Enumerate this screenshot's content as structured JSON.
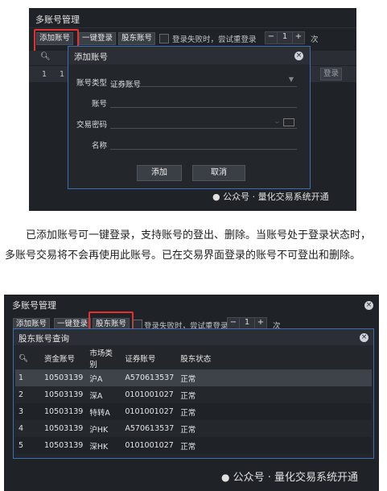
{
  "s1": {
    "window_title": "多账号管理",
    "toolbar": {
      "add_label": "添加账号",
      "onekey_label": "一键登录",
      "holder_label": "股东账号",
      "retry_text": "登录失败时，尝试重登录",
      "retry_value": "1",
      "retry_unit": "次"
    },
    "bg_row_num": "1",
    "bg_row_num2": "1",
    "bg_login": "登录",
    "dialog": {
      "title": "添加账号",
      "type_label": "账号类型",
      "type_value": "证券账号",
      "account_label": "账号",
      "password_label": "交易密码",
      "name_label": "名称",
      "add_button": "添加",
      "cancel_button": "取消"
    },
    "watermark": "公众号 · 量化交易系统开通"
  },
  "paragraph": "已添加账号可一键登录，支持账号的登出、删除。当账号处于登录状态时，多账号交易将不会再使用此账号。已在交易界面登录的账号不可登出和删除。",
  "s2": {
    "window_title": "多账号管理",
    "toolbar": {
      "add_label": "添加账号",
      "onekey_label": "一键登录",
      "holder_label": "股东账号",
      "retry_text": "登录失败时，尝试重登录",
      "retry_value": "1",
      "retry_unit": "次"
    },
    "dialog_title": "股东账号查询",
    "columns": [
      "资金账号",
      "市场类别",
      "证券账号",
      "股东状态"
    ],
    "rows": [
      {
        "n": "1",
        "fund": "10503139",
        "market": "沪A",
        "sec": "A570613537",
        "status": "正常"
      },
      {
        "n": "2",
        "fund": "10503139",
        "market": "深A",
        "sec": "0101001027",
        "status": "正常"
      },
      {
        "n": "3",
        "fund": "10503139",
        "market": "特转A",
        "sec": "0101001027",
        "status": "正常"
      },
      {
        "n": "4",
        "fund": "10503139",
        "market": "沪HK",
        "sec": "A570613537",
        "status": "正常"
      },
      {
        "n": "5",
        "fund": "10503139",
        "market": "深HK",
        "sec": "0101001027",
        "status": "正常"
      }
    ],
    "watermark": "公众号 · 量化交易系统开通"
  }
}
